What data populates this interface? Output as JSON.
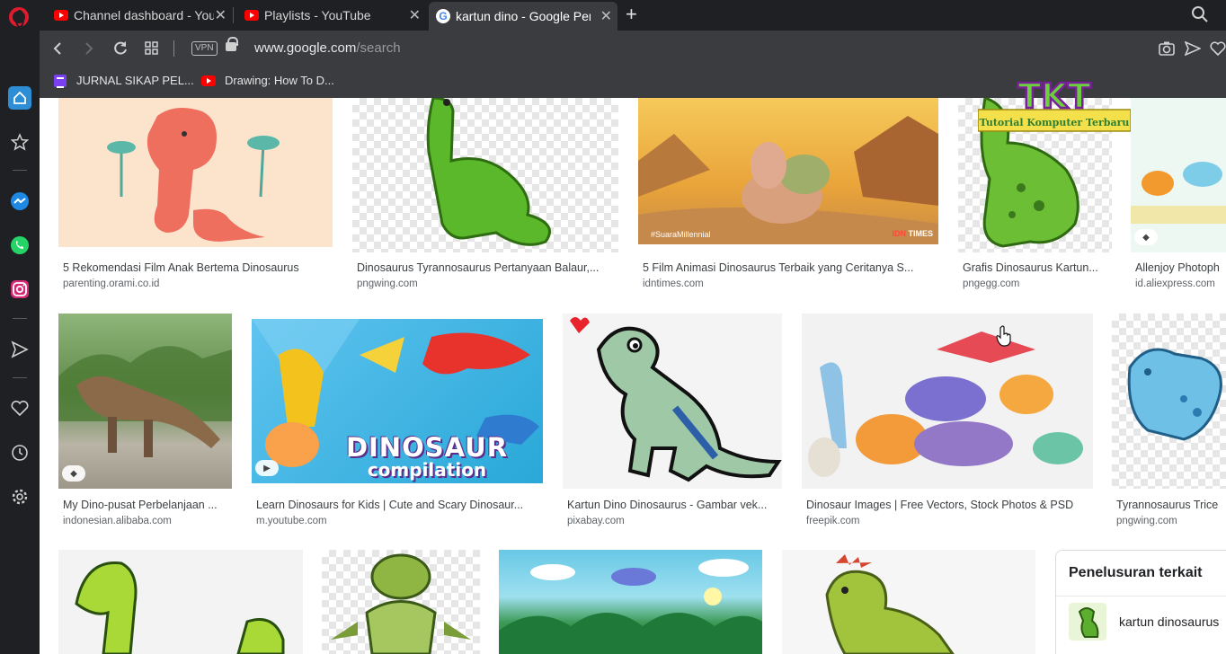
{
  "tabs": [
    {
      "title": "Channel dashboard - YouTube",
      "favicon": "youtube-icon",
      "active": false
    },
    {
      "title": "Playlists - YouTube",
      "favicon": "youtube-icon",
      "active": false
    },
    {
      "title": "kartun dino - Google Penelusuran",
      "favicon": "google-icon",
      "active": true
    }
  ],
  "address": {
    "vpn_label": "VPN",
    "url_host": "www.google.com",
    "url_path": "/search"
  },
  "bookmarks": [
    {
      "label": "JURNAL SIKAP PEL...",
      "icon": "list-icon"
    },
    {
      "label": "Drawing: How To D...",
      "icon": "youtube-icon"
    }
  ],
  "results": {
    "row1": [
      {
        "caption": "5 Rekomendasi Film Anak Bertema Dinosaurus",
        "source": "parenting.orami.co.id"
      },
      {
        "caption": "Dinosaurus Tyrannosaurus Pertanyaan Balaur,...",
        "source": "pngwing.com"
      },
      {
        "caption": "5 Film Animasi Dinosaurus Terbaik yang Ceritanya S...",
        "source": "idntimes.com",
        "watermark_left": "#SuaraMillennial",
        "watermark_right_a": "IDN",
        "watermark_right_b": " TIMES"
      },
      {
        "caption": "Grafis Dinosaurus Kartun...",
        "source": "pngegg.com"
      },
      {
        "caption": "Allenjoy Photoph",
        "source": "id.aliexpress.com"
      }
    ],
    "row2": [
      {
        "caption": "My Dino-pusat Perbelanjaan ...",
        "source": "indonesian.alibaba.com"
      },
      {
        "caption": "Learn Dinosaurs for Kids | Cute and Scary Dinosaur...",
        "source": "m.youtube.com",
        "thumb_title_1": "DINOSAUR",
        "thumb_title_2": "compilation"
      },
      {
        "caption": "Kartun Dino Dinosaurus - Gambar vek...",
        "source": "pixabay.com"
      },
      {
        "caption": "Dinosaur Images | Free Vectors, Stock Photos & PSD",
        "source": "freepik.com"
      },
      {
        "caption": "Tyrannosaurus Trice",
        "source": "pngwing.com"
      }
    ]
  },
  "related": {
    "title": "Penelusuran terkait",
    "items": [
      {
        "label": "kartun dinosaurus"
      }
    ]
  },
  "overlay": {
    "title": "TKT",
    "subtitle": "Tutorial Komputer Terbaru"
  },
  "colors": {
    "chrome_dark": "#1f2023",
    "chrome_mid": "#3b3c40",
    "opera_red": "#e01b2d",
    "youtube_red": "#ff0000"
  }
}
